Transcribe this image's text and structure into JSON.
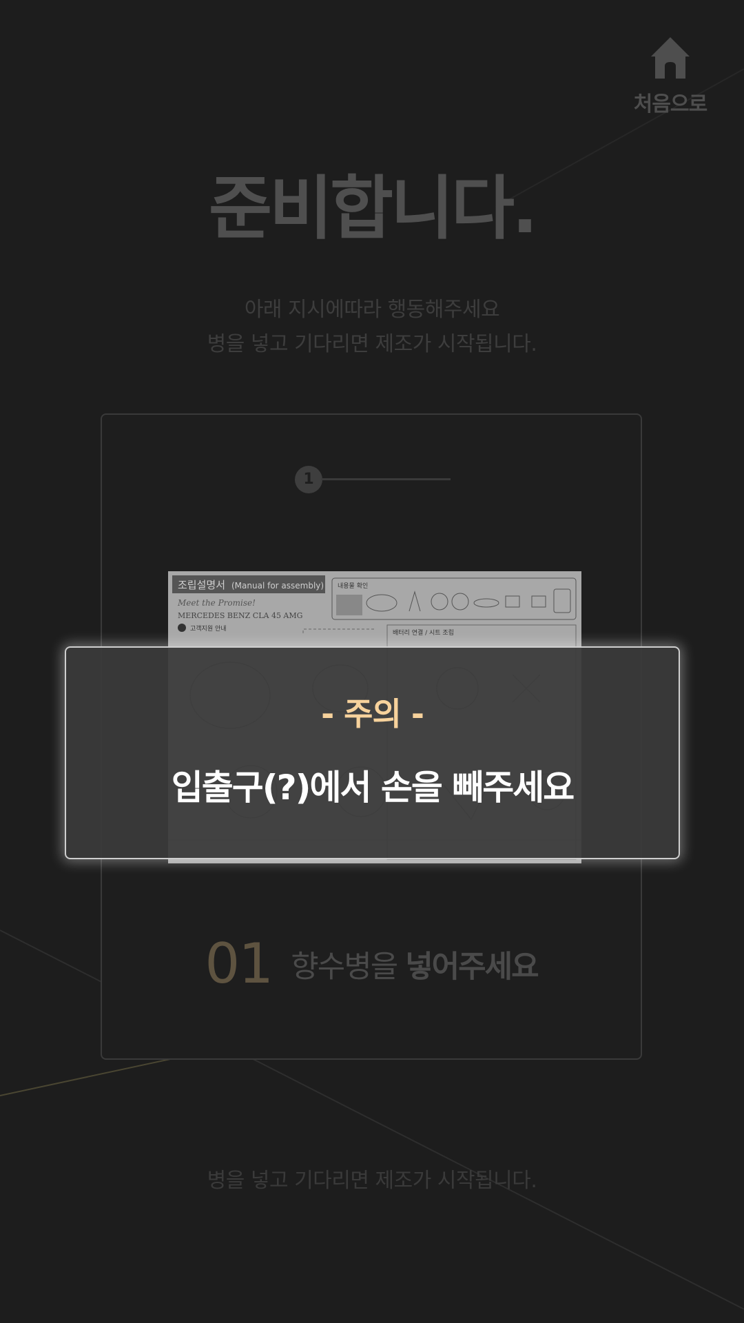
{
  "header": {
    "home_label": "처음으로",
    "home_icon": "home-icon"
  },
  "main": {
    "title": "준비합니다.",
    "subtitle_line1": "아래 지시에따라 행동해주세요",
    "subtitle_line2": "병을 넣고 기다리면 제조가 시작됩니다."
  },
  "step_card": {
    "step_indicator": "1",
    "manual": {
      "title": "조립설명서",
      "title_en": "(Manual for assembly)",
      "tagline": "Meet the Promise!",
      "model": "MERCEDES BENZ CLA 45 AMG",
      "section_contents": "내용물 확인",
      "section_battery": "배터리 연결 / 시트 조립",
      "customer_service": "고객지원 안내"
    },
    "step_number": "01",
    "step_text_light": "향수병을",
    "step_text_bold": "넣어주세요"
  },
  "footer": {
    "note": "병을 넣고 기다리면 제조가 시작됩니다."
  },
  "alert": {
    "title": "- 주의 -",
    "message": "입출구(?)에서 손을 빼주세요"
  },
  "colors": {
    "background": "#1d1d1d",
    "alert_title": "#f7d29c",
    "step_number": "#5e5340",
    "accent_line": "#5a5238"
  }
}
